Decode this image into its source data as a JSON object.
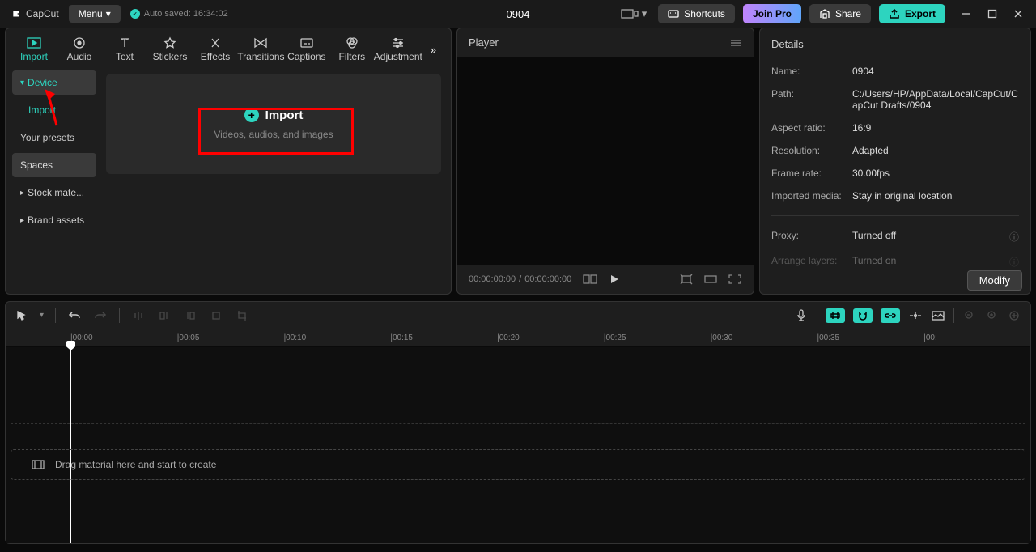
{
  "app": {
    "logo_text": "CapCut"
  },
  "titlebar": {
    "menu": "Menu",
    "autosave": "Auto saved: 16:34:02",
    "project_title": "0904",
    "shortcuts": "Shortcuts",
    "join_pro": "Join Pro",
    "share": "Share",
    "export": "Export"
  },
  "tabs": {
    "import": "Import",
    "audio": "Audio",
    "text": "Text",
    "stickers": "Stickers",
    "effects": "Effects",
    "transitions": "Transitions",
    "captions": "Captions",
    "filters": "Filters",
    "adjustment": "Adjustment"
  },
  "sidebar": {
    "device": "Device",
    "import": "Import",
    "presets": "Your presets",
    "spaces": "Spaces",
    "stock": "Stock mate...",
    "brand": "Brand assets"
  },
  "import_area": {
    "title": "Import",
    "subtitle": "Videos, audios, and images"
  },
  "player": {
    "title": "Player",
    "current": "00:00:00:00",
    "sep": "/",
    "total": "00:00:00:00"
  },
  "details": {
    "title": "Details",
    "rows": {
      "name": {
        "label": "Name:",
        "value": "0904"
      },
      "path": {
        "label": "Path:",
        "value": "C:/Users/HP/AppData/Local/CapCut/CapCut Drafts/0904"
      },
      "aspect": {
        "label": "Aspect ratio:",
        "value": "16:9"
      },
      "resolution": {
        "label": "Resolution:",
        "value": "Adapted"
      },
      "fps": {
        "label": "Frame rate:",
        "value": "30.00fps"
      },
      "imported": {
        "label": "Imported media:",
        "value": "Stay in original location"
      },
      "proxy": {
        "label": "Proxy:",
        "value": "Turned off"
      },
      "arrange": {
        "label": "Arrange layers:",
        "value": "Turned on"
      }
    },
    "modify": "Modify"
  },
  "timeline": {
    "ticks": [
      "|00:00",
      "|00:05",
      "|00:10",
      "|00:15",
      "|00:20",
      "|00:25",
      "|00:30",
      "|00:35",
      "|00:"
    ],
    "drop_text": "Drag material here and start to create"
  }
}
